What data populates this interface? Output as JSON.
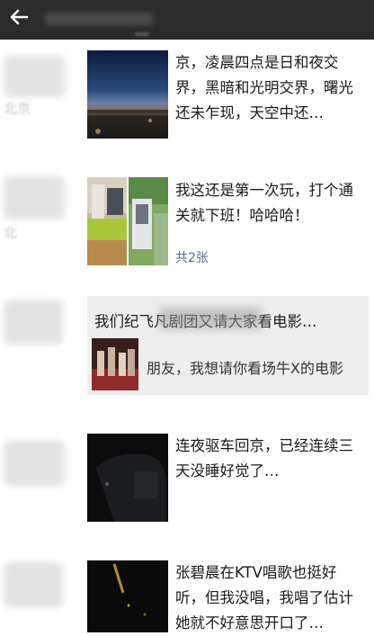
{
  "posts": [
    {
      "text": "京，凌晨四点是日和夜交界，黑暗和光明交界，曙光还未乍现，天空中还…",
      "date_text": "北京"
    },
    {
      "text": "我这还是第一次玩，打个通关就下班！哈哈哈！",
      "photo_count": "共2张",
      "date_text": "北"
    },
    {
      "share_title": "我们纪飞凡剧团又请大家看电影…",
      "share_desc": "朋友，我想请你看场牛X的电影"
    },
    {
      "text": "连夜驱车回京，已经连续三天没睡好觉了…"
    },
    {
      "text": "张碧晨在KTV唱歌也挺好听，但我没唱，我唱了估计她就不好意思开口了…"
    }
  ],
  "icons": {
    "back": "back-arrow-icon"
  },
  "colors": {
    "header": "#2b2b2b",
    "link": "#5b6b8c",
    "share_bg": "#eeeeee"
  }
}
